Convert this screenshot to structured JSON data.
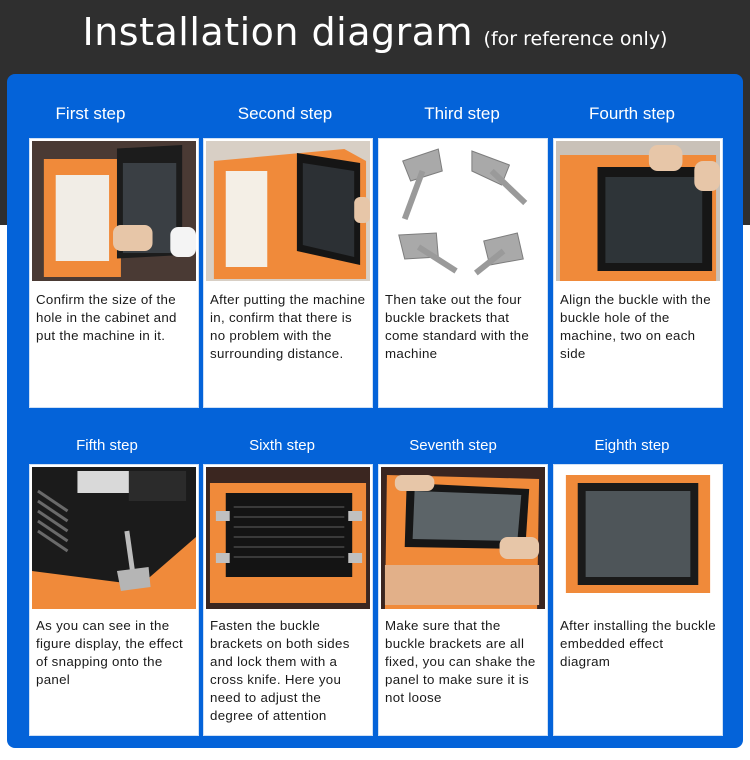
{
  "header": {
    "title": "Installation diagram",
    "subtitle": "(for reference only)"
  },
  "colors": {
    "header_bg": "#2f2f2f",
    "panel_blue": "#0463d9",
    "card_bg": "#ffffff",
    "cabinet_orange": "#f08a3a"
  },
  "steps": [
    {
      "label": "First step",
      "description": "Confirm the size of the hole in the cabinet and put the machine in it.",
      "image": "machine-into-cabinet-photo"
    },
    {
      "label": "Second step",
      "description": "After putting the machine in, confirm that there is no problem with the surrounding distance.",
      "image": "machine-in-cabinet-photo"
    },
    {
      "label": "Third step",
      "description": "Then take out the four buckle brackets that come standard with the machine",
      "image": "buckle-brackets-photo"
    },
    {
      "label": "Fourth step",
      "description": "Align the buckle with the buckle hole of the machine, two on each side",
      "image": "align-buckle-photo"
    },
    {
      "label": "Fifth step",
      "description": "As you can see in the figure display, the effect of snapping onto the panel",
      "image": "snap-onto-panel-photo"
    },
    {
      "label": "Sixth step",
      "description": "Fasten the buckle brackets on both sides and lock them with a cross knife. Here you need to adjust the degree of attention",
      "image": "fasten-brackets-photo"
    },
    {
      "label": "Seventh step",
      "description": "Make sure that the buckle brackets are all fixed, you can shake the panel to make sure it is not loose",
      "image": "shake-panel-photo"
    },
    {
      "label": "Eighth step",
      "description": "After installing the buckle embedded effect diagram",
      "image": "embedded-effect-photo"
    }
  ]
}
